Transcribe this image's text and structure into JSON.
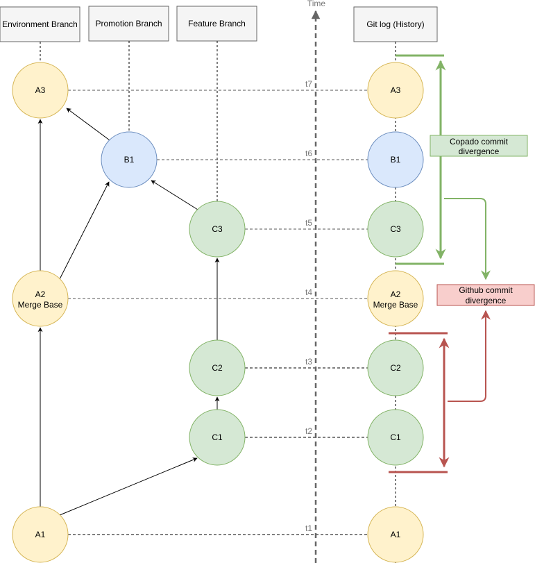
{
  "lanes": {
    "environment": "Environment Branch",
    "promotion": "Promotion Branch",
    "feature": "Feature Branch",
    "history": "Git log (History)"
  },
  "time_axis": {
    "label": "Time",
    "ticks": [
      "t1",
      "t2",
      "t3",
      "t4",
      "t5",
      "t6",
      "t7"
    ]
  },
  "branch_nodes": {
    "a1": "A1",
    "a2_line1": "A2",
    "a2_line2": "Merge Base",
    "a3": "A3",
    "b1": "B1",
    "c1": "C1",
    "c2": "C2",
    "c3": "C3"
  },
  "history_nodes": {
    "a1": "A1",
    "c1": "C1",
    "c2": "C2",
    "a2_line1": "A2",
    "a2_line2": "Merge Base",
    "c3": "C3",
    "b1": "B1",
    "a3": "A3"
  },
  "callouts": {
    "copado_line1": "Copado commit",
    "copado_line2": "divergence",
    "github_line1": "Github commit",
    "github_line2": "divergence"
  },
  "colors": {
    "env_fill": "#fff2cc",
    "env_stroke": "#d6b656",
    "promo_fill": "#dae8fc",
    "promo_stroke": "#6c8ebf",
    "feature_fill": "#d5e8d4",
    "feature_stroke": "#82b366",
    "copado_accent": "#82b366",
    "github_accent": "#b85450",
    "github_fill": "#f8cecc"
  }
}
